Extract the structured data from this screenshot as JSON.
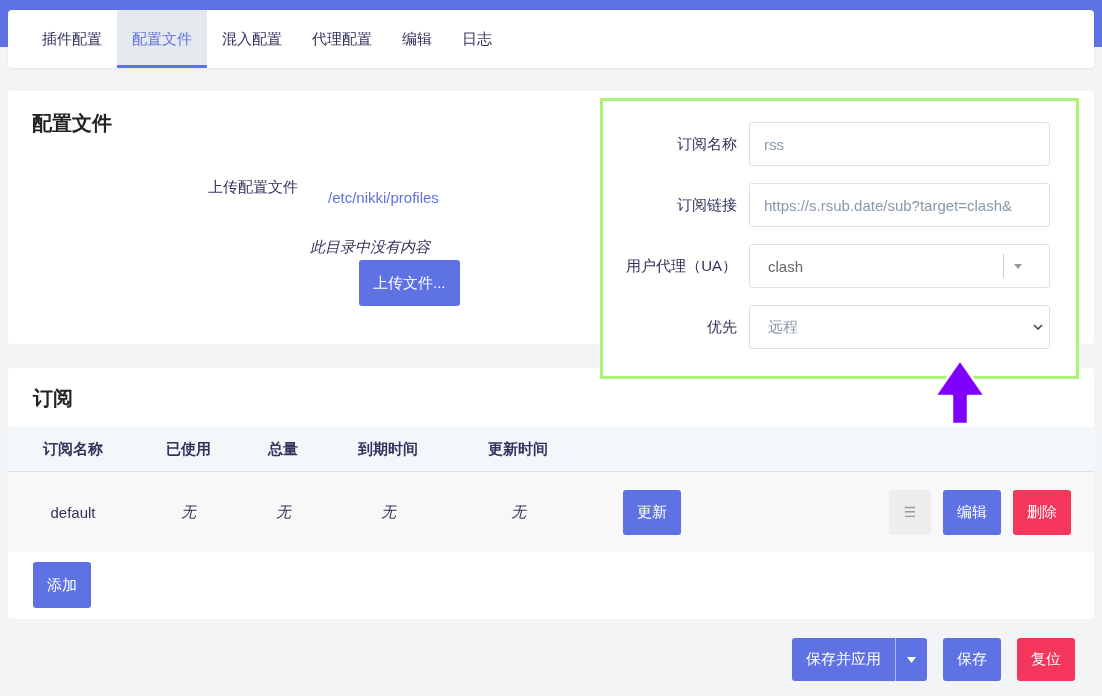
{
  "tabs": [
    {
      "label": "插件配置",
      "selected": false
    },
    {
      "label": "配置文件",
      "selected": true
    },
    {
      "label": "混入配置",
      "selected": false
    },
    {
      "label": "代理配置",
      "selected": false
    },
    {
      "label": "编辑",
      "selected": false
    },
    {
      "label": "日志",
      "selected": false
    }
  ],
  "profile_section": {
    "title": "配置文件",
    "upload_label": "上传配置文件",
    "path": "/etc/nikki/profiles",
    "empty_message": "此目录中没有内容",
    "upload_button": "上传文件..."
  },
  "subscription_section": {
    "title": "订阅",
    "columns": [
      "订阅名称",
      "已使用",
      "总量",
      "到期时间",
      "更新时间"
    ],
    "rows": [
      {
        "name": "default",
        "used": "无",
        "total": "无",
        "expiry": "无",
        "updated": "无",
        "update_button": "更新",
        "drag_handle": "☰",
        "edit_button": "编辑",
        "delete_button": "删除"
      }
    ],
    "add_button": "添加"
  },
  "subscription_form": {
    "fields": [
      {
        "kind": "text",
        "label": "订阅名称",
        "placeholder": "rss"
      },
      {
        "kind": "text",
        "label": "订阅链接",
        "placeholder": "https://s.rsub.date/sub?target=clash&"
      },
      {
        "kind": "combo",
        "label": "用户代理（UA）",
        "value": "clash"
      },
      {
        "kind": "select",
        "label": "优先",
        "value": "远程"
      }
    ]
  },
  "footer": {
    "buttons": [
      {
        "kind": "split",
        "label": "保存并应用"
      },
      {
        "kind": "primary",
        "label": "保存"
      },
      {
        "kind": "danger",
        "label": "复位"
      }
    ]
  }
}
